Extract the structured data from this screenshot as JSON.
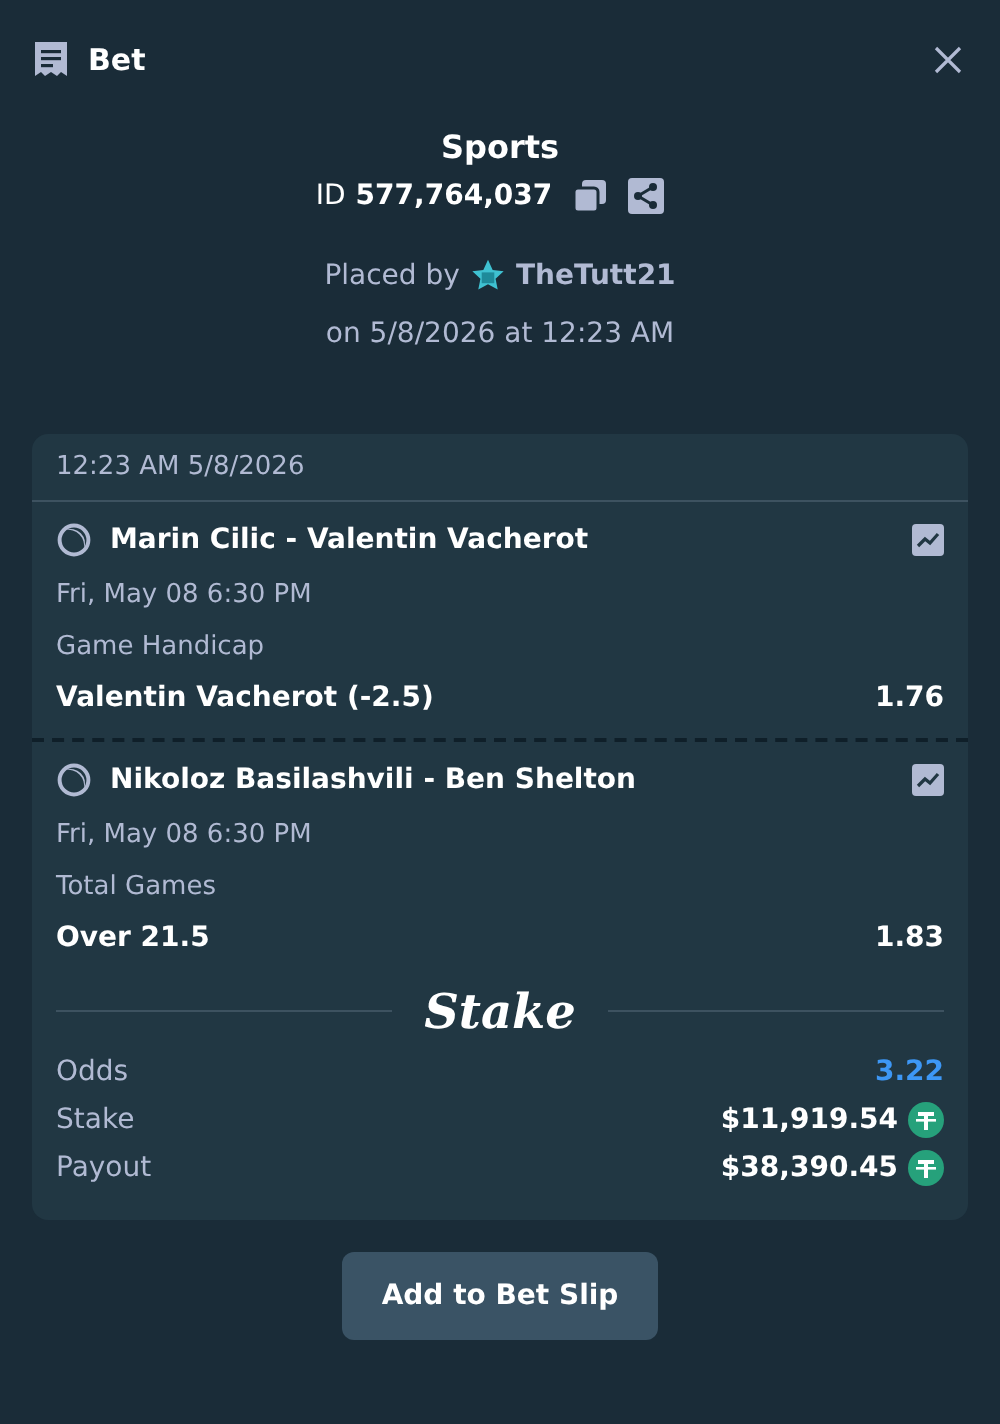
{
  "header": {
    "title": "Bet"
  },
  "bet": {
    "category": "Sports",
    "id_label": "ID",
    "id": "577,764,037",
    "placed_by_label": "Placed by",
    "user": "TheTutt21",
    "placed_on": "on 5/8/2026 at 12:23 AM"
  },
  "card": {
    "timestamp": "12:23 AM 5/8/2026",
    "legs": [
      {
        "event": "Marin Cilic - Valentin Vacherot",
        "datetime": "Fri, May 08  6:30 PM",
        "market": "Game Handicap",
        "selection": "Valentin Vacherot (-2.5)",
        "odds": "1.76"
      },
      {
        "event": "Nikoloz Basilashvili - Ben Shelton",
        "datetime": "Fri, May 08  6:30 PM",
        "market": "Total Games",
        "selection": "Over 21.5",
        "odds": "1.83"
      }
    ],
    "logo": "Stake",
    "summary": [
      {
        "kind": "odds",
        "label": "Odds",
        "value": "3.22"
      },
      {
        "kind": "amount",
        "label": "Stake",
        "value": "$11,919.54"
      },
      {
        "kind": "amount",
        "label": "Payout",
        "value": "$38,390.45"
      }
    ]
  },
  "button": "Add to Bet Slip"
}
